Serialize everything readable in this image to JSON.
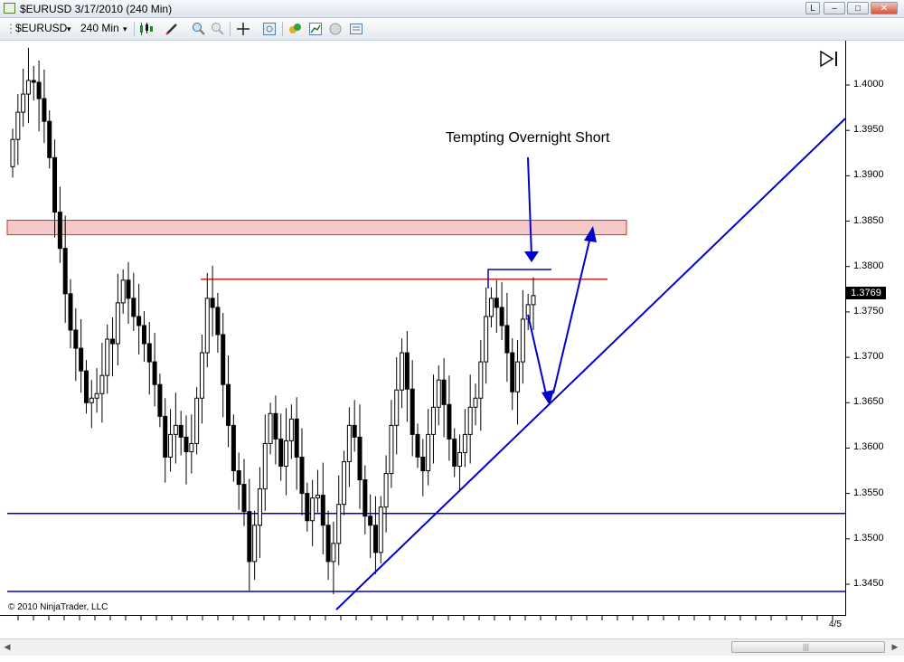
{
  "window": {
    "title": "$EURUSD  3/17/2010 (240 Min)",
    "buttons": {
      "lock": "L",
      "minimize": "–",
      "maximize": "□",
      "close": "✕"
    }
  },
  "toolbar": {
    "instrument": "$EURUSD",
    "interval": "240 Min",
    "dropdown_icon": "▾",
    "icons": [
      "bar-style-icon",
      "draw-pencil-icon",
      "zoom-in-icon",
      "zoom-out-icon",
      "crosshair-icon",
      "data-box-icon",
      "strategies-icon",
      "indicators-icon",
      "properties-icon",
      "chart-trader-icon"
    ]
  },
  "chart": {
    "annotation": "Tempting Overnight Short",
    "current_price": "1.3769",
    "copyright": "© 2010 NinjaTrader, LLC",
    "x_label": "4/5",
    "colors": {
      "candle": "#000000",
      "trend_lines": "#0000cc",
      "resistance": "#cc0000",
      "zone_fill": "#f5c6c6"
    }
  },
  "chart_data": {
    "type": "candlestick",
    "title": "",
    "ylim": [
      1.342,
      1.4045
    ],
    "yticks": [
      "1.4000",
      "1.3950",
      "1.3900",
      "1.3850",
      "1.3800",
      "1.3750",
      "1.3700",
      "1.3650",
      "1.3600",
      "1.3550",
      "1.3500",
      "1.3450"
    ],
    "closes": [
      1.394,
      1.397,
      1.399,
      1.4005,
      1.4003,
      1.3985,
      1.396,
      1.392,
      1.386,
      1.382,
      1.377,
      1.373,
      1.371,
      1.3685,
      1.365,
      1.3655,
      1.366,
      1.368,
      1.372,
      1.3715,
      1.376,
      1.3785,
      1.3765,
      1.3745,
      1.3735,
      1.3715,
      1.3695,
      1.367,
      1.3635,
      1.359,
      1.3615,
      1.3625,
      1.3612,
      1.3596,
      1.3605,
      1.3655,
      1.3705,
      1.3765,
      1.3755,
      1.3725,
      1.367,
      1.3625,
      1.3575,
      1.356,
      1.353,
      1.3475,
      1.3515,
      1.3555,
      1.3605,
      1.3638,
      1.361,
      1.358,
      1.3608,
      1.3632,
      1.359,
      1.355,
      1.352,
      1.3545,
      1.3548,
      1.3515,
      1.3475,
      1.3495,
      1.3538,
      1.3585,
      1.3625,
      1.3612,
      1.3565,
      1.3525,
      1.3515,
      1.3485,
      1.3535,
      1.3572,
      1.3625,
      1.3664,
      1.3705,
      1.3665,
      1.3615,
      1.359,
      1.3575,
      1.3615,
      1.3645,
      1.3675,
      1.3648,
      1.361,
      1.358,
      1.3595,
      1.3615,
      1.3645,
      1.3655,
      1.3695,
      1.3745,
      1.3765,
      1.3755,
      1.3735,
      1.3705,
      1.3662,
      1.3695,
      1.3742,
      1.3758,
      1.3768
    ],
    "levels": [
      {
        "name": "resistance-zone",
        "from": 1.3835,
        "to": 1.3851
      },
      {
        "name": "resistance-line",
        "value": 1.3786
      },
      {
        "name": "support-line-1",
        "value": 1.3528
      },
      {
        "name": "support-line-2",
        "value": 1.3442
      }
    ],
    "trendline": {
      "from": 1.3422,
      "to": 1.3963
    }
  }
}
